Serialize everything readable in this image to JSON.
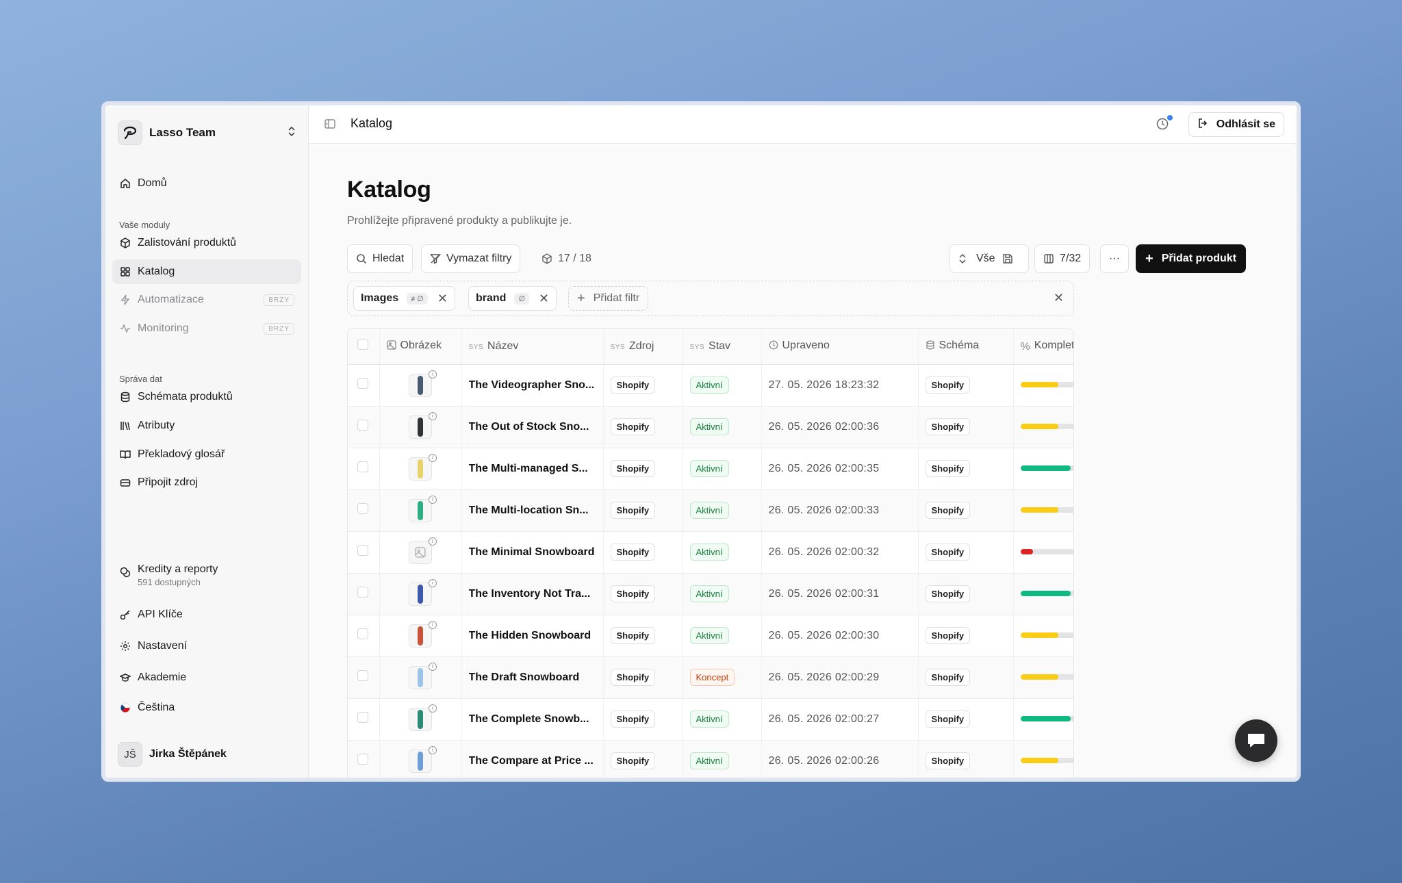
{
  "sidebar": {
    "team_name": "Lasso Team",
    "home": "Domů",
    "modules_label": "Vaše moduly",
    "modules": [
      {
        "label": "Zalistování produktů",
        "icon": "cube-icon"
      },
      {
        "label": "Katalog",
        "icon": "grid-icon",
        "active": true
      },
      {
        "label": "Automatizace",
        "icon": "bolt-icon",
        "badge": "BRZY"
      },
      {
        "label": "Monitoring",
        "icon": "activity-icon",
        "badge": "BRZY"
      }
    ],
    "data_label": "Správa dat",
    "data_items": [
      {
        "label": "Schémata produktů",
        "icon": "database-icon"
      },
      {
        "label": "Atributy",
        "icon": "library-icon"
      },
      {
        "label": "Překladový glosář",
        "icon": "book-icon"
      },
      {
        "label": "Připojit zdroj",
        "icon": "drive-icon"
      }
    ],
    "credits": {
      "label": "Kredity a reporty",
      "sub": "591 dostupných"
    },
    "api_keys": "API Klíče",
    "settings": "Nastavení",
    "academy": "Akademie",
    "language": "Čeština",
    "user": {
      "initials": "JŠ",
      "name": "Jirka Štěpánek"
    }
  },
  "topbar": {
    "breadcrumb": "Katalog",
    "logout": "Odhlásit se"
  },
  "page": {
    "title": "Katalog",
    "subtitle": "Prohlížejte připravené produkty a publikujte je."
  },
  "toolbar": {
    "search": "Hledat",
    "clear_filters": "Vymazat filtry",
    "count": "17 / 18",
    "view": "Vše",
    "columns": "7/32",
    "more": "···",
    "add_product": "Přidat produkt"
  },
  "filters": [
    {
      "field": "Images",
      "op": "≠ ∅"
    },
    {
      "field": "brand",
      "op": "∅"
    }
  ],
  "add_filter": "Přidat filtr",
  "table": {
    "columns": {
      "image": "Obrázek",
      "name": "Název",
      "source": "Zdroj",
      "status": "Stav",
      "updated": "Upraveno",
      "schema": "Schéma",
      "completeness": "Kompletnost",
      "sys": "SYS"
    },
    "rows": [
      {
        "name": "The Videographer Sno...",
        "source": "Shopify",
        "status": "Aktivní",
        "updated": "27. 05. 2026 18:23:32",
        "schema": "Shopify",
        "completeness": 60,
        "pct": "60%",
        "board_color": "#4a5a72"
      },
      {
        "name": "The Out of Stock Sno...",
        "source": "Shopify",
        "status": "Aktivní",
        "updated": "26. 05. 2026 02:00:36",
        "schema": "Shopify",
        "completeness": 60,
        "pct": "60%",
        "board_color": "#2f3338"
      },
      {
        "name": "The Multi-managed S...",
        "source": "Shopify",
        "status": "Aktivní",
        "updated": "26. 05. 2026 02:00:35",
        "schema": "Shopify",
        "completeness": 80,
        "pct": "80%",
        "board_color": "#e8d36a"
      },
      {
        "name": "The Multi-location Sn...",
        "source": "Shopify",
        "status": "Aktivní",
        "updated": "26. 05. 2026 02:00:33",
        "schema": "Shopify",
        "completeness": 60,
        "pct": "60%",
        "board_color": "#2fae86"
      },
      {
        "name": "The Minimal Snowboard",
        "source": "Shopify",
        "status": "Aktivní",
        "updated": "26. 05. 2026 02:00:32",
        "schema": "Shopify",
        "completeness": 20,
        "pct": "20%",
        "board_color": ""
      },
      {
        "name": "The Inventory Not Tra...",
        "source": "Shopify",
        "status": "Aktivní",
        "updated": "26. 05. 2026 02:00:31",
        "schema": "Shopify",
        "completeness": 80,
        "pct": "80%",
        "board_color": "#3c58a8"
      },
      {
        "name": "The Hidden Snowboard",
        "source": "Shopify",
        "status": "Aktivní",
        "updated": "26. 05. 2026 02:00:30",
        "schema": "Shopify",
        "completeness": 60,
        "pct": "60%",
        "board_color": "#c9523a"
      },
      {
        "name": "The Draft Snowboard",
        "source": "Shopify",
        "status": "Koncept",
        "updated": "26. 05. 2026 02:00:29",
        "schema": "Shopify",
        "completeness": 60,
        "pct": "60%",
        "board_color": "#9cc4e6"
      },
      {
        "name": "The Complete Snowb...",
        "source": "Shopify",
        "status": "Aktivní",
        "updated": "26. 05. 2026 02:00:27",
        "schema": "Shopify",
        "completeness": 80,
        "pct": "80%",
        "board_color": "#2a8a74"
      },
      {
        "name": "The Compare at Price ...",
        "source": "Shopify",
        "status": "Aktivní",
        "updated": "26. 05. 2026 02:00:26",
        "schema": "Shopify",
        "completeness": 60,
        "pct": "60%",
        "board_color": "#6f9fd6"
      }
    ]
  },
  "colors": {
    "bar_low": "#dc2626",
    "bar_mid": "#facc15",
    "bar_high": "#10b981",
    "primary": "#111111",
    "notification_dot": "#3b82f6"
  }
}
